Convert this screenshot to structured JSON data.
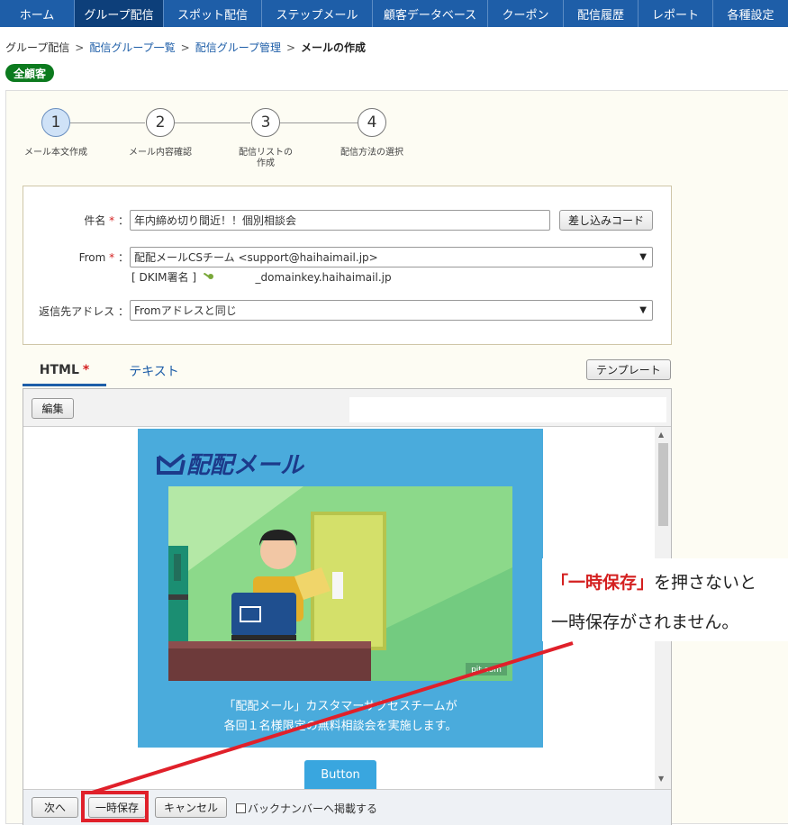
{
  "nav": {
    "items": [
      {
        "label": "ホーム",
        "active": false
      },
      {
        "label": "グループ配信",
        "active": true
      },
      {
        "label": "スポット配信",
        "active": false
      },
      {
        "label": "ステップメール",
        "active": false
      },
      {
        "label": "顧客データベース",
        "active": false
      },
      {
        "label": "クーポン",
        "active": false
      },
      {
        "label": "配信履歴",
        "active": false
      },
      {
        "label": "レポート",
        "active": false
      },
      {
        "label": "各種設定",
        "active": false
      }
    ],
    "colors": {
      "bar": "#1e5ea8",
      "active": "#0d3f7a"
    }
  },
  "breadcrumb": {
    "root": "グループ配信",
    "link1": "配信グループ一覧",
    "link2": "配信グループ管理",
    "current": "メールの作成",
    "separator": ">"
  },
  "segment_badge": "全顧客",
  "stepper": {
    "steps": [
      {
        "number": "1",
        "label": "メール本文作成",
        "active": true
      },
      {
        "number": "2",
        "label": "メール内容確認",
        "active": false
      },
      {
        "number": "3",
        "label_line1": "配信リストの",
        "label_line2": "作成",
        "active": false
      },
      {
        "number": "4",
        "label": "配信方法の選択",
        "active": false
      }
    ]
  },
  "form": {
    "subject_label": "件名",
    "subject_value": "年内締め切り間近！！個別相談会",
    "insert_code_button": "差し込みコード",
    "from_label": "From",
    "from_value": "配配メールCSチーム <support@haihaimail.jp>",
    "dkim_prefix": "[ DKIM署名 ]",
    "dkim_domain": "_domainkey.haihaimail.jp",
    "reply_label": "返信先アドレス",
    "reply_value": "Fromアドレスと同じ",
    "required_mark": "*",
    "colon": "："
  },
  "tabs": {
    "html": "HTML",
    "html_required": "*",
    "text": "テキスト",
    "template_button": "テンプレート"
  },
  "editor": {
    "edit_button": "編集",
    "preview": {
      "logo_text": "配配メール",
      "watermark": "pit.com",
      "caption_line1": "「配配メール」カスタマーサクセスチームが",
      "caption_line2": "各回１名様限定の無料相談会を実施します。",
      "button_label": "Button"
    }
  },
  "footer": {
    "next_button": "次へ",
    "save_temp_button": "一時保存",
    "cancel_button": "キャンセル",
    "backnumber_label": "バックナンバーへ掲載する",
    "backnumber_checked": false
  },
  "callout": {
    "highlight": "「一時保存」",
    "line1_rest": "を押さないと",
    "line2": "一時保存がされません。",
    "accent_color": "#e0202a"
  }
}
